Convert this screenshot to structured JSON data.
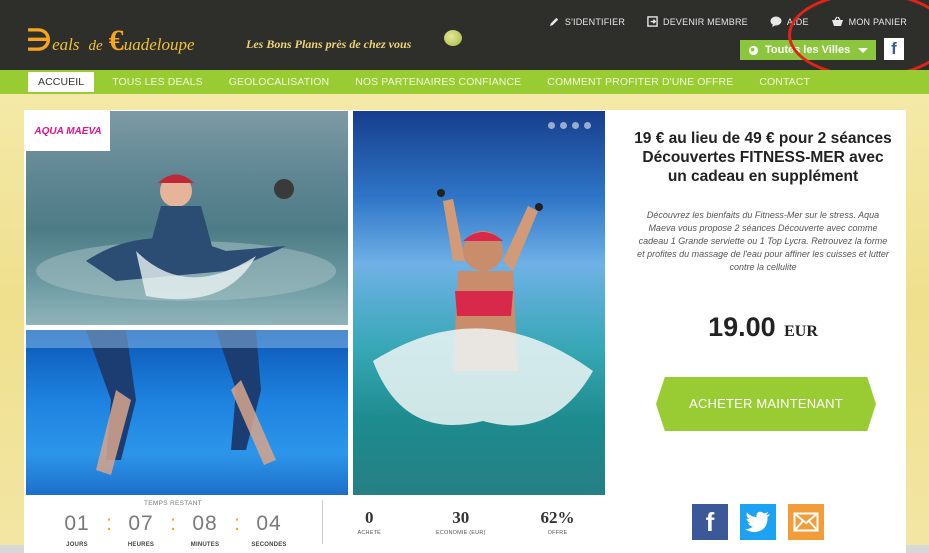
{
  "logo": {
    "w1": "eals",
    "w2": "de",
    "w3": "uadeloupe",
    "mark1": "∋",
    "mark2": "€"
  },
  "tagline": "Les Bons Plans près de chez vous",
  "toplinks": [
    {
      "label": "S'IDENTIFIER",
      "icon": "pencil-icon"
    },
    {
      "label": "DEVENIR MEMBRE",
      "icon": "signup-icon"
    },
    {
      "label": "AIDE",
      "icon": "help-bubble-icon"
    },
    {
      "label": "MON PANIER",
      "icon": "basket-icon"
    }
  ],
  "city_selector": {
    "label": "Toutes les Villes"
  },
  "facebook_small": "f",
  "nav": [
    "ACCUEIL",
    "TOUS LES DEALS",
    "GEOLOCALISATION",
    "NOS PARTENAIRES CONFIANCE",
    "COMMENT PROFITER D'UNE OFFRE",
    "CONTACT"
  ],
  "partner_logo": "AQUA MAEVA",
  "deal": {
    "title": "19 € au lieu de 49 € pour 2 séances Découvertes FITNESS-MER avec un cadeau en supplément",
    "description": "Découvrez les bienfaits du Fitness-Mer sur le stress. Aqua Maeva vous propose 2 séances Découverte avec comme cadeau 1 Grande serviette ou 1 Top Lycra. Retrouvez la forme et profites du massage de l'eau pour affiner les cuisses et lutter contre la cellulite",
    "price": "19.00",
    "currency": "EUR",
    "buy_label": "ACHETER MAINTENANT"
  },
  "timer": {
    "label": "TEMPS RESTANT",
    "days": "01",
    "hours": "07",
    "minutes": "08",
    "seconds": "04",
    "days_label": "JOURS",
    "hours_label": "HEURES",
    "minutes_label": "MINUTES",
    "seconds_label": "SECONDES",
    "separator": ":"
  },
  "stats": [
    {
      "value": "0",
      "label": "ACHETÉ"
    },
    {
      "value": "30",
      "label": "ECONOMIE (EUR)"
    },
    {
      "value": "62%",
      "label": "OFFRE"
    }
  ],
  "share": {
    "facebook": "f"
  },
  "colors": {
    "green": "#99cc33",
    "header": "#2e2e2a",
    "orange": "#f5a51e",
    "annotation": "#e2231a"
  }
}
